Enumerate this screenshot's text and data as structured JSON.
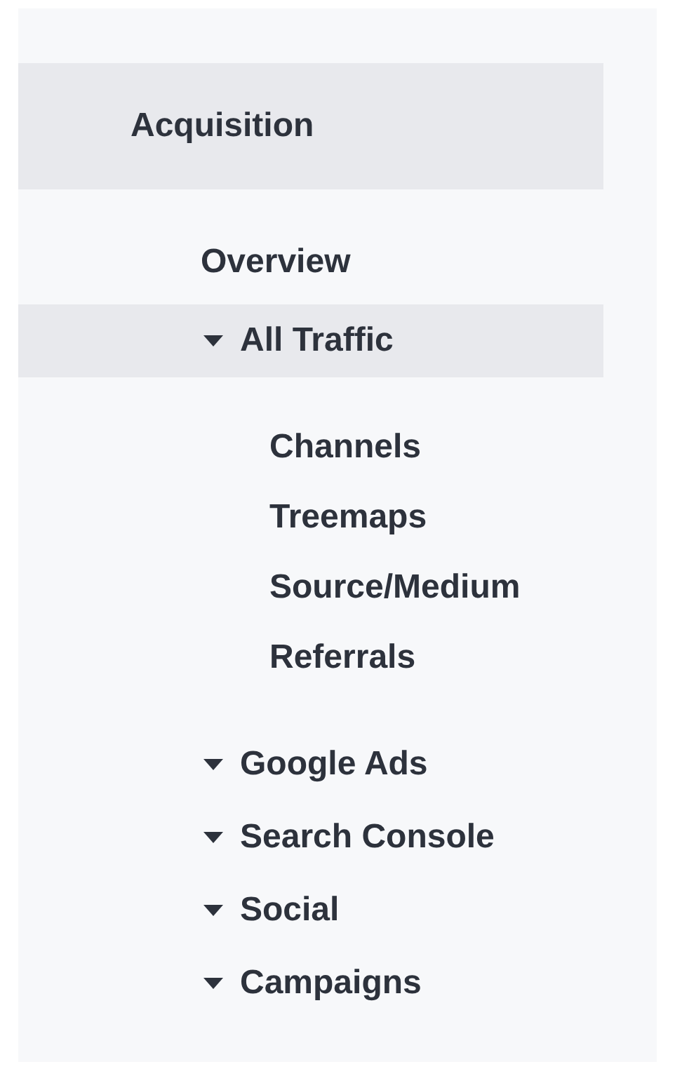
{
  "nav": {
    "title": "Acquisition",
    "selected": true,
    "items": [
      {
        "label": "Overview",
        "kind": "link",
        "selected": false
      },
      {
        "label": "All Traffic",
        "kind": "group",
        "expanded": true,
        "selected": true,
        "children": [
          {
            "label": "Channels",
            "selected": false
          },
          {
            "label": "Treemaps",
            "selected": false
          },
          {
            "label": "Source/Medium",
            "selected": false
          },
          {
            "label": "Referrals",
            "selected": false
          }
        ]
      },
      {
        "label": "Google Ads",
        "kind": "group",
        "expanded": true,
        "selected": false
      },
      {
        "label": "Search Console",
        "kind": "group",
        "expanded": true,
        "selected": false
      },
      {
        "label": "Social",
        "kind": "group",
        "expanded": true,
        "selected": false
      },
      {
        "label": "Campaigns",
        "kind": "group",
        "expanded": true,
        "selected": false
      }
    ]
  }
}
